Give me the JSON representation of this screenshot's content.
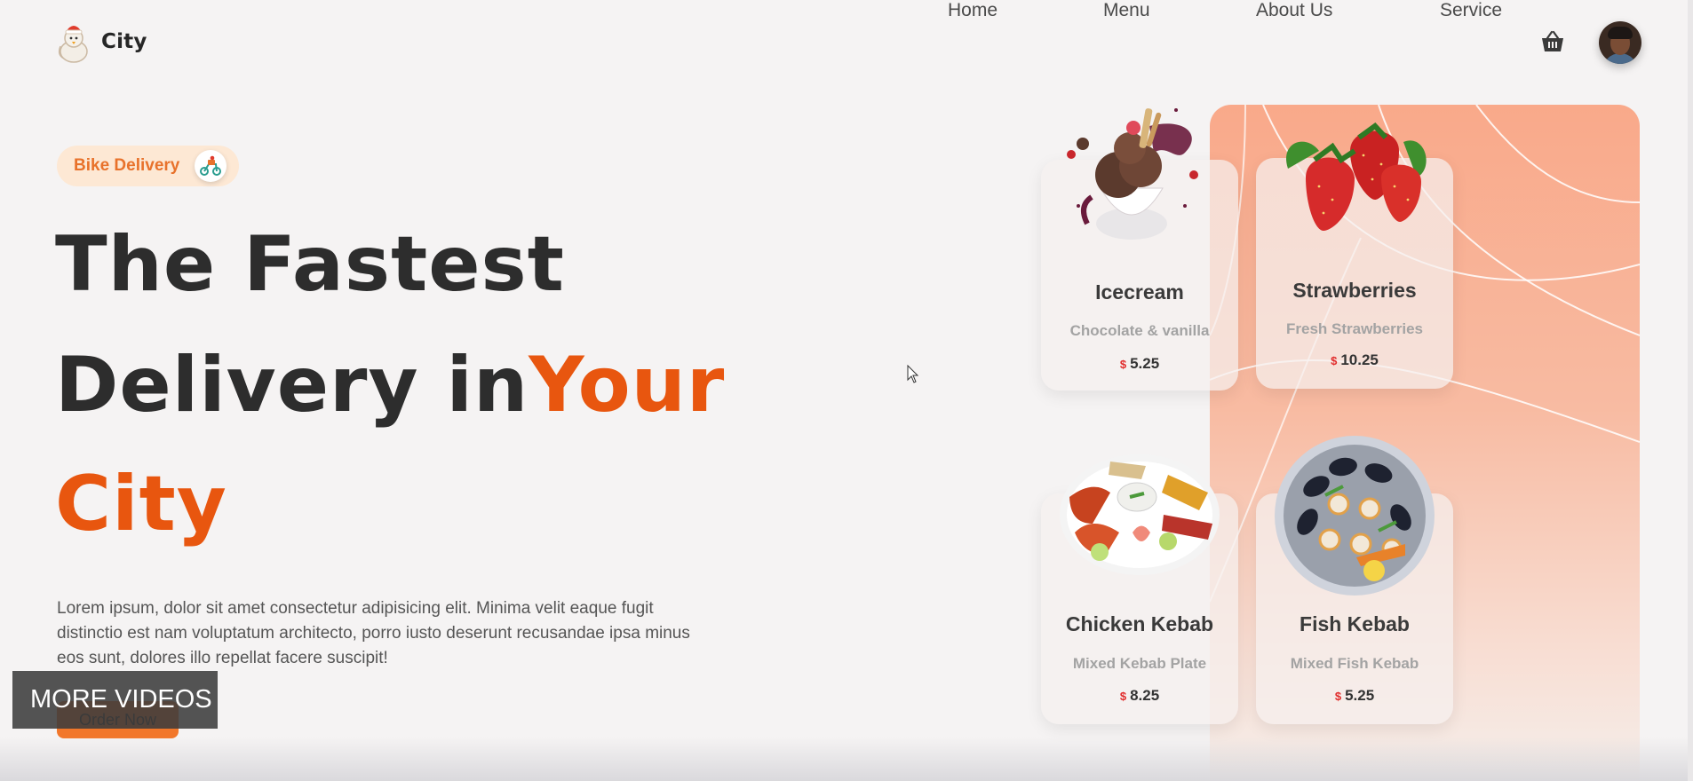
{
  "brand": {
    "name": "City"
  },
  "nav": {
    "items": [
      "Home",
      "Menu",
      "About Us",
      "Service"
    ]
  },
  "icons": {
    "cart": "basket-icon",
    "avatar": "user-avatar",
    "badge": "scooter-icon"
  },
  "hero": {
    "badge": "Bike Delivery",
    "line1": "The Fastest",
    "line2_a": "Delivery in",
    "line2_b": "Your",
    "line3": "City",
    "description": "Lorem ipsum, dolor sit amet consectetur adipisicing elit. Minima velit eaque fugit distinctio est nam voluptatum architecto, porro iusto deserunt recusandae ipsa minus eos sunt, dolores illo repellat facere suscipit!",
    "cta": "Order Now"
  },
  "overlay": {
    "more_videos": "MORE VIDEOS"
  },
  "cards": [
    {
      "name": "Icecream",
      "subtitle": "Chocolate & vanilla",
      "currency": "$",
      "price": "5.25",
      "image": "icecream-image"
    },
    {
      "name": "Strawberries",
      "subtitle": "Fresh Strawberries",
      "currency": "$",
      "price": "10.25",
      "image": "strawberries-image"
    },
    {
      "name": "Chicken Kebab",
      "subtitle": "Mixed Kebab Plate",
      "currency": "$",
      "price": "8.25",
      "image": "chicken-kebab-image"
    },
    {
      "name": "Fish Kebab",
      "subtitle": "Mixed Fish Kebab",
      "currency": "$",
      "price": "5.25",
      "image": "fish-kebab-image"
    }
  ],
  "colors": {
    "accent": "#e8560f",
    "button": "#f2772a",
    "badge_bg": "#fde8d4",
    "panel": "#f9a98a"
  }
}
